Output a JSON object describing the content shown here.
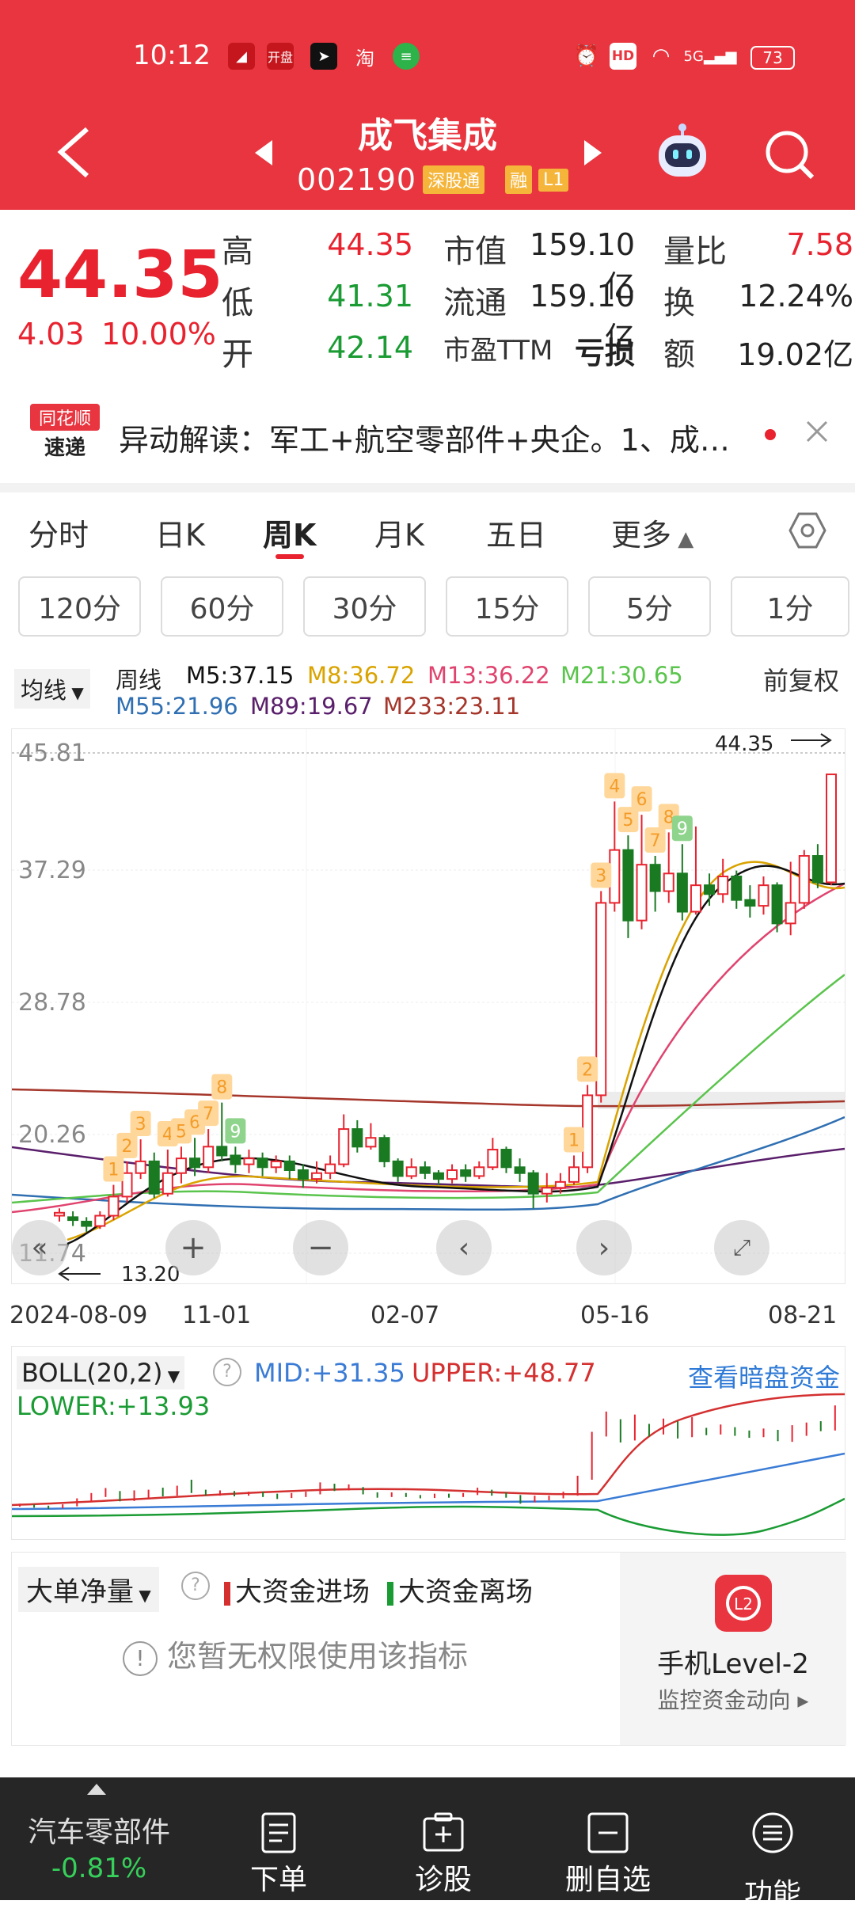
{
  "status": {
    "time": "10:12",
    "battery": "73",
    "net": "5G",
    "hd": "HD",
    "app_label": "开盘",
    "app_taobao": "淘"
  },
  "header": {
    "name": "成飞集成",
    "code": "002190",
    "tag_tong": "深股通",
    "tag_rong": "融",
    "tag_level": "L1"
  },
  "quote": {
    "price": "44.35",
    "change": "4.03",
    "change_pct": "10.00%",
    "high_label": "高",
    "high": "44.35",
    "low_label": "低",
    "low": "41.31",
    "open_label": "开",
    "open": "42.14",
    "mktcap_label": "市值",
    "mktcap": "159.10亿",
    "float_label": "流通",
    "float": "159.10亿",
    "pe_label": "市盈TTM",
    "pe": "亏损",
    "vr_label": "量比",
    "vr": "7.58",
    "turnover_label": "换",
    "turnover": "12.24%",
    "amount_label": "额",
    "amount": "19.02亿"
  },
  "news": {
    "logo_top": "同花顺",
    "logo_bottom": "速递",
    "text": "异动解读：军工+航空零部件+央企。1、成…"
  },
  "period_tabs": [
    "分时",
    "日K",
    "周K",
    "月K",
    "五日",
    "更多"
  ],
  "minute_tabs": [
    "120分",
    "60分",
    "30分",
    "15分",
    "5分",
    "1分"
  ],
  "ma": {
    "select": "均线",
    "period": "周线",
    "m5": "M5:37.15",
    "m8": "M8:36.72",
    "m13": "M13:36.22",
    "m21": "M21:30.65",
    "m55": "M55:21.96",
    "m89": "M89:19.67",
    "m233": "M233:23.11",
    "adjust": "前复权",
    "colors": {
      "m5": "#111111",
      "m8": "#d9a300",
      "m13": "#e0436e",
      "m21": "#5ac44c",
      "m55": "#2f6fb2",
      "m89": "#5a1f6b",
      "m233": "#a5362b"
    }
  },
  "chart_data": {
    "type": "candlestick",
    "y_labels": [
      "45.81",
      "37.29",
      "28.78",
      "20.26",
      "11.74"
    ],
    "ylim": [
      11.74,
      45.81
    ],
    "max_marker": "44.35",
    "min_marker": "13.20",
    "x_labels": [
      "2024-08-09",
      "11-01",
      "02-07",
      "05-16",
      "08-21"
    ],
    "candles": [
      {
        "o": 14.3,
        "c": 14.5,
        "h": 14.8,
        "l": 13.9
      },
      {
        "o": 14.2,
        "c": 14.0,
        "h": 14.6,
        "l": 13.6
      },
      {
        "o": 13.9,
        "c": 13.6,
        "h": 14.2,
        "l": 13.2
      },
      {
        "o": 13.6,
        "c": 14.3,
        "h": 14.6,
        "l": 13.4
      },
      {
        "o": 14.3,
        "c": 15.6,
        "h": 16.4,
        "l": 14.0
      },
      {
        "o": 15.6,
        "c": 17.2,
        "h": 18.0,
        "l": 15.2
      },
      {
        "o": 17.2,
        "c": 18.0,
        "h": 19.5,
        "l": 16.8
      },
      {
        "o": 18.0,
        "c": 15.8,
        "h": 18.6,
        "l": 15.5
      },
      {
        "o": 15.8,
        "c": 17.2,
        "h": 18.8,
        "l": 15.6
      },
      {
        "o": 17.2,
        "c": 18.2,
        "h": 19.0,
        "l": 16.5
      },
      {
        "o": 18.2,
        "c": 17.6,
        "h": 19.6,
        "l": 17.0
      },
      {
        "o": 17.6,
        "c": 19.0,
        "h": 20.2,
        "l": 17.2
      },
      {
        "o": 19.0,
        "c": 18.4,
        "h": 22.0,
        "l": 18.0
      },
      {
        "o": 18.4,
        "c": 17.8,
        "h": 19.0,
        "l": 17.2
      },
      {
        "o": 17.8,
        "c": 18.2,
        "h": 18.8,
        "l": 17.2
      },
      {
        "o": 18.2,
        "c": 17.6,
        "h": 18.6,
        "l": 17.0
      },
      {
        "o": 17.6,
        "c": 18.0,
        "h": 18.4,
        "l": 17.2
      },
      {
        "o": 18.0,
        "c": 17.4,
        "h": 18.4,
        "l": 16.8
      },
      {
        "o": 17.4,
        "c": 16.8,
        "h": 17.8,
        "l": 16.2
      },
      {
        "o": 16.8,
        "c": 17.2,
        "h": 18.0,
        "l": 16.5
      },
      {
        "o": 17.2,
        "c": 17.8,
        "h": 18.4,
        "l": 16.8
      },
      {
        "o": 17.8,
        "c": 20.2,
        "h": 21.2,
        "l": 17.6
      },
      {
        "o": 20.2,
        "c": 19.0,
        "h": 20.8,
        "l": 18.6
      },
      {
        "o": 19.0,
        "c": 19.6,
        "h": 20.6,
        "l": 18.8
      },
      {
        "o": 19.6,
        "c": 18.0,
        "h": 19.8,
        "l": 17.6
      },
      {
        "o": 18.0,
        "c": 17.0,
        "h": 18.2,
        "l": 16.6
      },
      {
        "o": 17.0,
        "c": 17.6,
        "h": 18.2,
        "l": 16.8
      },
      {
        "o": 17.6,
        "c": 17.2,
        "h": 18.0,
        "l": 16.8
      },
      {
        "o": 17.2,
        "c": 16.8,
        "h": 17.4,
        "l": 16.4
      },
      {
        "o": 16.8,
        "c": 17.4,
        "h": 17.8,
        "l": 16.5
      },
      {
        "o": 17.4,
        "c": 17.0,
        "h": 17.8,
        "l": 16.6
      },
      {
        "o": 17.0,
        "c": 17.6,
        "h": 18.0,
        "l": 16.8
      },
      {
        "o": 17.6,
        "c": 18.8,
        "h": 19.6,
        "l": 17.4
      },
      {
        "o": 18.8,
        "c": 17.6,
        "h": 19.0,
        "l": 17.2
      },
      {
        "o": 17.6,
        "c": 17.2,
        "h": 18.2,
        "l": 16.6
      },
      {
        "o": 17.2,
        "c": 15.8,
        "h": 17.4,
        "l": 14.8
      },
      {
        "o": 15.8,
        "c": 16.2,
        "h": 17.2,
        "l": 15.2
      },
      {
        "o": 16.2,
        "c": 16.6,
        "h": 17.2,
        "l": 15.8
      },
      {
        "o": 16.6,
        "c": 17.6,
        "h": 18.4,
        "l": 16.4
      },
      {
        "o": 17.6,
        "c": 22.5,
        "h": 23.2,
        "l": 17.2
      },
      {
        "o": 22.5,
        "c": 35.6,
        "h": 36.4,
        "l": 22.0
      },
      {
        "o": 35.6,
        "c": 39.2,
        "h": 42.5,
        "l": 35.0
      },
      {
        "o": 39.2,
        "c": 34.4,
        "h": 40.2,
        "l": 33.2
      },
      {
        "o": 34.4,
        "c": 38.2,
        "h": 41.6,
        "l": 33.8
      },
      {
        "o": 38.2,
        "c": 36.4,
        "h": 38.8,
        "l": 35.0
      },
      {
        "o": 36.4,
        "c": 37.6,
        "h": 40.4,
        "l": 35.6
      },
      {
        "o": 37.6,
        "c": 35.0,
        "h": 39.6,
        "l": 34.4
      },
      {
        "o": 35.0,
        "c": 36.8,
        "h": 40.8,
        "l": 34.8
      },
      {
        "o": 36.8,
        "c": 36.2,
        "h": 37.6,
        "l": 35.4
      },
      {
        "o": 36.2,
        "c": 37.4,
        "h": 38.6,
        "l": 35.6
      },
      {
        "o": 37.4,
        "c": 35.8,
        "h": 37.8,
        "l": 35.2
      },
      {
        "o": 35.8,
        "c": 35.4,
        "h": 36.8,
        "l": 34.6
      },
      {
        "o": 35.4,
        "c": 36.8,
        "h": 37.4,
        "l": 34.8
      },
      {
        "o": 36.8,
        "c": 34.2,
        "h": 37.0,
        "l": 33.6
      },
      {
        "o": 34.2,
        "c": 35.6,
        "h": 38.4,
        "l": 33.4
      },
      {
        "o": 35.6,
        "c": 38.8,
        "h": 39.2,
        "l": 35.2
      },
      {
        "o": 38.8,
        "c": 37.0,
        "h": 39.6,
        "l": 36.6
      },
      {
        "o": 37.0,
        "c": 44.35,
        "h": 44.35,
        "l": 36.8
      }
    ],
    "tags": [
      {
        "i": 4,
        "t": "1",
        "g": false
      },
      {
        "i": 5,
        "t": "2",
        "g": false
      },
      {
        "i": 6,
        "t": "3",
        "g": false
      },
      {
        "i": 8,
        "t": "4",
        "g": false
      },
      {
        "i": 9,
        "t": "5",
        "g": false
      },
      {
        "i": 10,
        "t": "6",
        "g": false
      },
      {
        "i": 11,
        "t": "7",
        "g": false
      },
      {
        "i": 12,
        "t": "8",
        "g": false
      },
      {
        "i": 13,
        "t": "9",
        "g": true
      },
      {
        "i": 38,
        "t": "1",
        "g": false
      },
      {
        "i": 39,
        "t": "2",
        "g": false
      },
      {
        "i": 40,
        "t": "3",
        "g": false
      },
      {
        "i": 41,
        "t": "4",
        "g": false
      },
      {
        "i": 42,
        "t": "5",
        "g": false
      },
      {
        "i": 43,
        "t": "6",
        "g": false
      },
      {
        "i": 44,
        "t": "7",
        "g": false
      },
      {
        "i": 45,
        "t": "8",
        "g": false
      },
      {
        "i": 46,
        "t": "9",
        "g": true
      }
    ]
  },
  "boll": {
    "select": "BOLL(20,2)",
    "mid": "MID:+31.35",
    "upper": "UPPER:+48.77",
    "lower": "LOWER:+13.93",
    "link": "查看暗盘资金"
  },
  "funds": {
    "select": "大单净量",
    "inflow": "大资金进场",
    "outflow": "大资金离场",
    "notice": "您暂无权限使用该指标",
    "level2_title": "手机Level-2",
    "level2_sub": "监控资金动向"
  },
  "bottom": {
    "sector": "汽车零部件",
    "sector_chg": "-0.81%",
    "order": "下单",
    "diagnose": "诊股",
    "remove_watch": "删自选",
    "more": "功能"
  }
}
